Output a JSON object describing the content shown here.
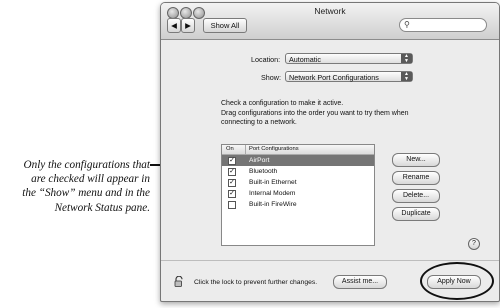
{
  "annotation": {
    "lines": [
      "Only  the configurations that",
      "are checked will appear in",
      "the “Show” menu and in the",
      "Network Status pane."
    ]
  },
  "window": {
    "title": "Network",
    "show_all_label": "Show All",
    "search": {
      "icon": "magnifier-icon",
      "value": ""
    }
  },
  "location": {
    "label": "Location:",
    "value": "Automatic"
  },
  "show": {
    "label": "Show:",
    "value": "Network Port Configurations"
  },
  "instructions": [
    "Check a configuration to make it active.",
    "Drag configurations into the order you want to try them when",
    "connecting to a network."
  ],
  "table": {
    "headers": {
      "on": "On",
      "config": "Port Configurations"
    },
    "rows": [
      {
        "name": "AirPort",
        "checked": true,
        "selected": true
      },
      {
        "name": "Bluetooth",
        "checked": true,
        "selected": false
      },
      {
        "name": "Built-in Ethernet",
        "checked": true,
        "selected": false
      },
      {
        "name": "Internal Modem",
        "checked": true,
        "selected": false
      },
      {
        "name": "Built-in FireWire",
        "checked": false,
        "selected": false
      }
    ]
  },
  "buttons": {
    "new": "New...",
    "rename": "Rename",
    "delete": "Delete...",
    "duplicate": "Duplicate",
    "help": "?",
    "assist": "Assist me...",
    "apply": "Apply Now"
  },
  "lock_text": "Click the lock to prevent further changes.",
  "check_mark": "✓"
}
